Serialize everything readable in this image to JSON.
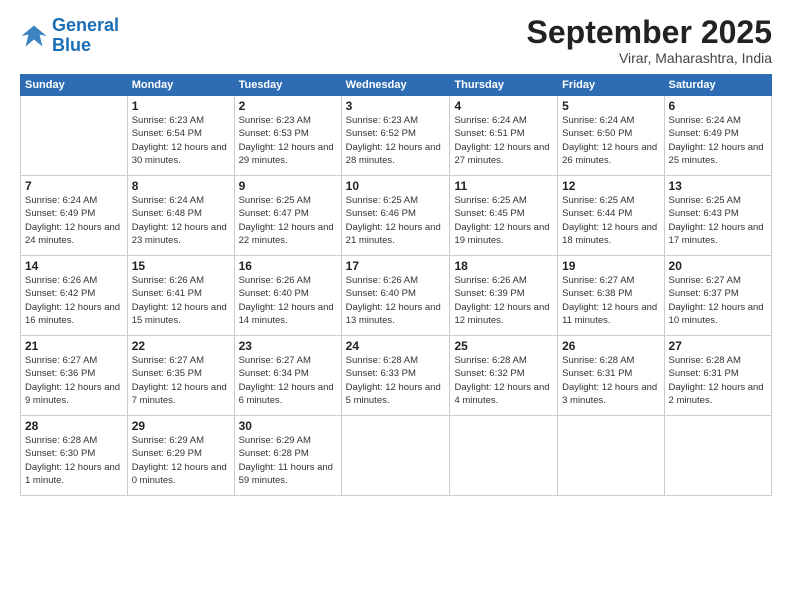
{
  "logo": {
    "line1": "General",
    "line2": "Blue"
  },
  "title": "September 2025",
  "location": "Virar, Maharashtra, India",
  "days_of_week": [
    "Sunday",
    "Monday",
    "Tuesday",
    "Wednesday",
    "Thursday",
    "Friday",
    "Saturday"
  ],
  "weeks": [
    [
      {
        "day": "",
        "sunrise": "",
        "sunset": "",
        "daylight": ""
      },
      {
        "day": "1",
        "sunrise": "Sunrise: 6:23 AM",
        "sunset": "Sunset: 6:54 PM",
        "daylight": "Daylight: 12 hours and 30 minutes."
      },
      {
        "day": "2",
        "sunrise": "Sunrise: 6:23 AM",
        "sunset": "Sunset: 6:53 PM",
        "daylight": "Daylight: 12 hours and 29 minutes."
      },
      {
        "day": "3",
        "sunrise": "Sunrise: 6:23 AM",
        "sunset": "Sunset: 6:52 PM",
        "daylight": "Daylight: 12 hours and 28 minutes."
      },
      {
        "day": "4",
        "sunrise": "Sunrise: 6:24 AM",
        "sunset": "Sunset: 6:51 PM",
        "daylight": "Daylight: 12 hours and 27 minutes."
      },
      {
        "day": "5",
        "sunrise": "Sunrise: 6:24 AM",
        "sunset": "Sunset: 6:50 PM",
        "daylight": "Daylight: 12 hours and 26 minutes."
      },
      {
        "day": "6",
        "sunrise": "Sunrise: 6:24 AM",
        "sunset": "Sunset: 6:49 PM",
        "daylight": "Daylight: 12 hours and 25 minutes."
      }
    ],
    [
      {
        "day": "7",
        "sunrise": "Sunrise: 6:24 AM",
        "sunset": "Sunset: 6:49 PM",
        "daylight": "Daylight: 12 hours and 24 minutes."
      },
      {
        "day": "8",
        "sunrise": "Sunrise: 6:24 AM",
        "sunset": "Sunset: 6:48 PM",
        "daylight": "Daylight: 12 hours and 23 minutes."
      },
      {
        "day": "9",
        "sunrise": "Sunrise: 6:25 AM",
        "sunset": "Sunset: 6:47 PM",
        "daylight": "Daylight: 12 hours and 22 minutes."
      },
      {
        "day": "10",
        "sunrise": "Sunrise: 6:25 AM",
        "sunset": "Sunset: 6:46 PM",
        "daylight": "Daylight: 12 hours and 21 minutes."
      },
      {
        "day": "11",
        "sunrise": "Sunrise: 6:25 AM",
        "sunset": "Sunset: 6:45 PM",
        "daylight": "Daylight: 12 hours and 19 minutes."
      },
      {
        "day": "12",
        "sunrise": "Sunrise: 6:25 AM",
        "sunset": "Sunset: 6:44 PM",
        "daylight": "Daylight: 12 hours and 18 minutes."
      },
      {
        "day": "13",
        "sunrise": "Sunrise: 6:25 AM",
        "sunset": "Sunset: 6:43 PM",
        "daylight": "Daylight: 12 hours and 17 minutes."
      }
    ],
    [
      {
        "day": "14",
        "sunrise": "Sunrise: 6:26 AM",
        "sunset": "Sunset: 6:42 PM",
        "daylight": "Daylight: 12 hours and 16 minutes."
      },
      {
        "day": "15",
        "sunrise": "Sunrise: 6:26 AM",
        "sunset": "Sunset: 6:41 PM",
        "daylight": "Daylight: 12 hours and 15 minutes."
      },
      {
        "day": "16",
        "sunrise": "Sunrise: 6:26 AM",
        "sunset": "Sunset: 6:40 PM",
        "daylight": "Daylight: 12 hours and 14 minutes."
      },
      {
        "day": "17",
        "sunrise": "Sunrise: 6:26 AM",
        "sunset": "Sunset: 6:40 PM",
        "daylight": "Daylight: 12 hours and 13 minutes."
      },
      {
        "day": "18",
        "sunrise": "Sunrise: 6:26 AM",
        "sunset": "Sunset: 6:39 PM",
        "daylight": "Daylight: 12 hours and 12 minutes."
      },
      {
        "day": "19",
        "sunrise": "Sunrise: 6:27 AM",
        "sunset": "Sunset: 6:38 PM",
        "daylight": "Daylight: 12 hours and 11 minutes."
      },
      {
        "day": "20",
        "sunrise": "Sunrise: 6:27 AM",
        "sunset": "Sunset: 6:37 PM",
        "daylight": "Daylight: 12 hours and 10 minutes."
      }
    ],
    [
      {
        "day": "21",
        "sunrise": "Sunrise: 6:27 AM",
        "sunset": "Sunset: 6:36 PM",
        "daylight": "Daylight: 12 hours and 9 minutes."
      },
      {
        "day": "22",
        "sunrise": "Sunrise: 6:27 AM",
        "sunset": "Sunset: 6:35 PM",
        "daylight": "Daylight: 12 hours and 7 minutes."
      },
      {
        "day": "23",
        "sunrise": "Sunrise: 6:27 AM",
        "sunset": "Sunset: 6:34 PM",
        "daylight": "Daylight: 12 hours and 6 minutes."
      },
      {
        "day": "24",
        "sunrise": "Sunrise: 6:28 AM",
        "sunset": "Sunset: 6:33 PM",
        "daylight": "Daylight: 12 hours and 5 minutes."
      },
      {
        "day": "25",
        "sunrise": "Sunrise: 6:28 AM",
        "sunset": "Sunset: 6:32 PM",
        "daylight": "Daylight: 12 hours and 4 minutes."
      },
      {
        "day": "26",
        "sunrise": "Sunrise: 6:28 AM",
        "sunset": "Sunset: 6:31 PM",
        "daylight": "Daylight: 12 hours and 3 minutes."
      },
      {
        "day": "27",
        "sunrise": "Sunrise: 6:28 AM",
        "sunset": "Sunset: 6:31 PM",
        "daylight": "Daylight: 12 hours and 2 minutes."
      }
    ],
    [
      {
        "day": "28",
        "sunrise": "Sunrise: 6:28 AM",
        "sunset": "Sunset: 6:30 PM",
        "daylight": "Daylight: 12 hours and 1 minute."
      },
      {
        "day": "29",
        "sunrise": "Sunrise: 6:29 AM",
        "sunset": "Sunset: 6:29 PM",
        "daylight": "Daylight: 12 hours and 0 minutes."
      },
      {
        "day": "30",
        "sunrise": "Sunrise: 6:29 AM",
        "sunset": "Sunset: 6:28 PM",
        "daylight": "Daylight: 11 hours and 59 minutes."
      },
      {
        "day": "",
        "sunrise": "",
        "sunset": "",
        "daylight": ""
      },
      {
        "day": "",
        "sunrise": "",
        "sunset": "",
        "daylight": ""
      },
      {
        "day": "",
        "sunrise": "",
        "sunset": "",
        "daylight": ""
      },
      {
        "day": "",
        "sunrise": "",
        "sunset": "",
        "daylight": ""
      }
    ]
  ]
}
